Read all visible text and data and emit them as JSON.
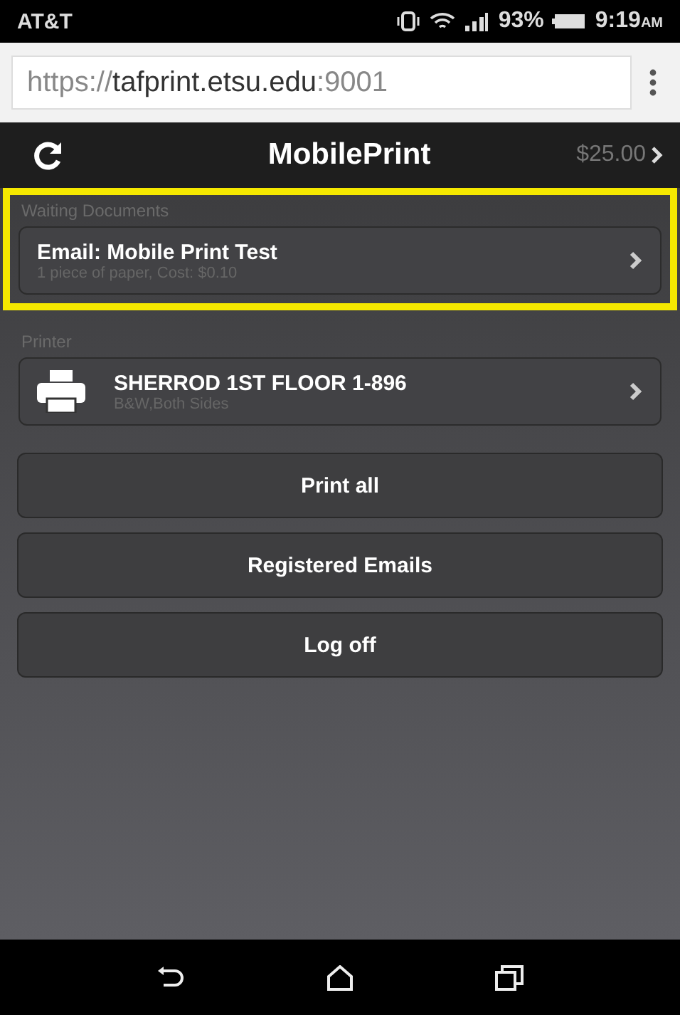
{
  "status_bar": {
    "carrier": "AT&T",
    "battery": "93%",
    "time": "9:19",
    "time_suffix": "AM"
  },
  "browser": {
    "url": "https://**tafprint.etsu.edu**:9001"
  },
  "header": {
    "title": "MobilePrint",
    "balance": "$25.00"
  },
  "sections": [
    {
      "kind": "document",
      "label": "Waiting Documents",
      "highlighted": true,
      "title": "Email: Mobile Print Test",
      "subtitle": "1 piece of paper, Cost: $0.10"
    },
    {
      "kind": "printer",
      "label": "Printer",
      "highlighted": false,
      "title": "SHERROD 1ST FLOOR 1-896",
      "subtitle": "B&W,Both Sides"
    }
  ],
  "buttons": [
    "Print all",
    "Registered Emails",
    "Log off"
  ]
}
